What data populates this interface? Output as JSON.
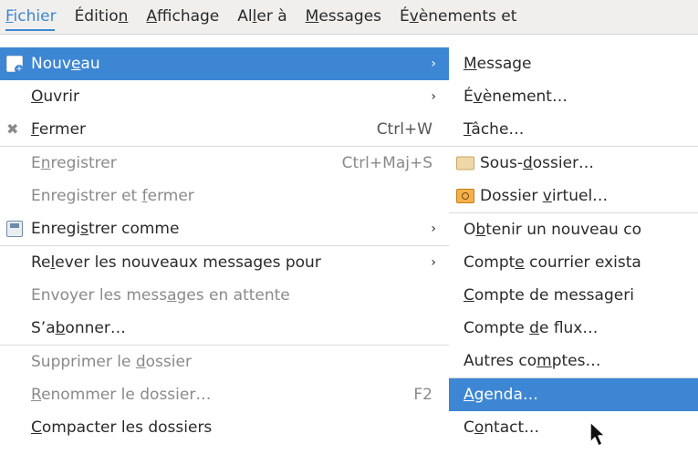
{
  "menubar": {
    "items": [
      {
        "pre": "",
        "u": "F",
        "post": "ichier"
      },
      {
        "pre": "Éditio",
        "u": "n",
        "post": ""
      },
      {
        "pre": "",
        "u": "A",
        "post": "ffichage"
      },
      {
        "pre": "Al",
        "u": "l",
        "post": "er à"
      },
      {
        "pre": "",
        "u": "M",
        "post": "essages"
      },
      {
        "pre": "É",
        "u": "v",
        "post": "ènements et"
      }
    ]
  },
  "main_menu": {
    "items": [
      {
        "pre": "Nouv",
        "u": "e",
        "post": "au",
        "shortcut": "",
        "arrow": "›",
        "icon": "new-icon"
      },
      {
        "pre": "",
        "u": "O",
        "post": "uvrir",
        "shortcut": "",
        "arrow": "›"
      },
      {
        "pre": "",
        "u": "F",
        "post": "ermer",
        "shortcut": "Ctrl+W",
        "arrow": "",
        "icon": "close-icon"
      },
      {
        "pre": "E",
        "u": "n",
        "post": "registrer",
        "shortcut": "Ctrl+Maj+S",
        "arrow": ""
      },
      {
        "pre": "Enregistrer et ",
        "u": "f",
        "post": "ermer",
        "shortcut": "",
        "arrow": ""
      },
      {
        "pre": "Enregi",
        "u": "s",
        "post": "trer comme",
        "shortcut": "",
        "arrow": "›",
        "icon": "save-as-icon"
      },
      {
        "pre": "Re",
        "u": "l",
        "post": "ever les nouveaux messages pour",
        "shortcut": "",
        "arrow": "›"
      },
      {
        "pre": "Envoyer les mess",
        "u": "a",
        "post": "ges en attente",
        "shortcut": "",
        "arrow": ""
      },
      {
        "pre": "S’a",
        "u": "b",
        "post": "onner…",
        "shortcut": "",
        "arrow": ""
      },
      {
        "pre": "Supprimer le ",
        "u": "d",
        "post": "ossier",
        "shortcut": "",
        "arrow": ""
      },
      {
        "pre": "",
        "u": "R",
        "post": "enommer le dossier…",
        "shortcut": "F2",
        "arrow": ""
      },
      {
        "pre": "",
        "u": "C",
        "post": "ompacter les dossiers",
        "shortcut": "",
        "arrow": ""
      }
    ]
  },
  "sub_menu": {
    "items": [
      {
        "pre": "",
        "u": "M",
        "post": "essage"
      },
      {
        "pre": "É",
        "u": "v",
        "post": "ènement…"
      },
      {
        "pre": "",
        "u": "T",
        "post": "âche…"
      },
      {
        "pre": "Sous-",
        "u": "d",
        "post": "ossier…",
        "icon": "folder-icon"
      },
      {
        "pre": "Dossier ",
        "u": "v",
        "post": "irtuel…",
        "icon": "virtual-folder-icon"
      },
      {
        "pre": "O",
        "u": "b",
        "post": "tenir un nouveau co"
      },
      {
        "pre": "Compt",
        "u": "e",
        "post": " courrier exista"
      },
      {
        "pre": "",
        "u": "C",
        "post": "ompte de messageri"
      },
      {
        "pre": "Compte ",
        "u": "d",
        "post": "e flux…"
      },
      {
        "pre": "Autres co",
        "u": "m",
        "post": "ptes…"
      },
      {
        "pre": "",
        "u": "A",
        "post": "genda…"
      },
      {
        "pre": "C",
        "u": "o",
        "post": "ntact…"
      }
    ]
  }
}
